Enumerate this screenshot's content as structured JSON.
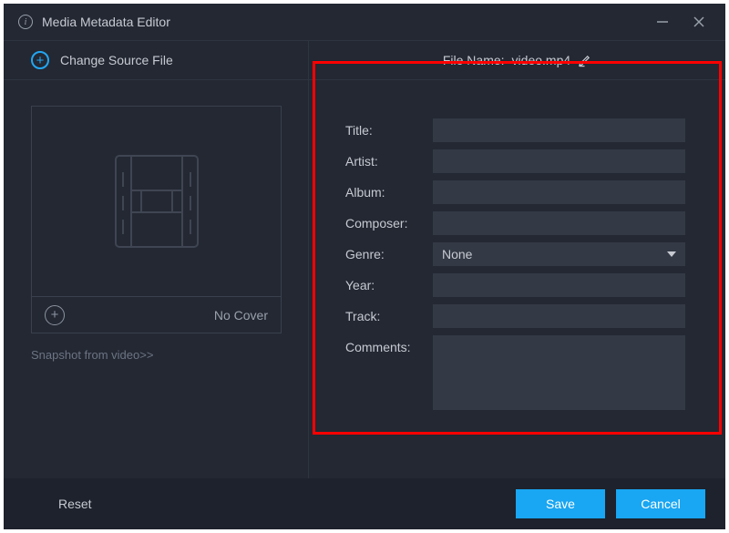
{
  "window": {
    "title": "Media Metadata Editor"
  },
  "toolbar": {
    "change_source": "Change Source File",
    "filename_label": "File Name:",
    "filename_value": "video.mp4"
  },
  "cover": {
    "no_cover_label": "No Cover",
    "snapshot_link": "Snapshot from video>>"
  },
  "fields": {
    "title": {
      "label": "Title:",
      "value": ""
    },
    "artist": {
      "label": "Artist:",
      "value": ""
    },
    "album": {
      "label": "Album:",
      "value": ""
    },
    "composer": {
      "label": "Composer:",
      "value": ""
    },
    "genre": {
      "label": "Genre:",
      "value": "None"
    },
    "year": {
      "label": "Year:",
      "value": ""
    },
    "track": {
      "label": "Track:",
      "value": ""
    },
    "comments": {
      "label": "Comments:",
      "value": ""
    }
  },
  "footer": {
    "reset": "Reset",
    "save": "Save",
    "cancel": "Cancel"
  },
  "colors": {
    "accent": "#19a6f2",
    "highlight": "#ff0000"
  }
}
